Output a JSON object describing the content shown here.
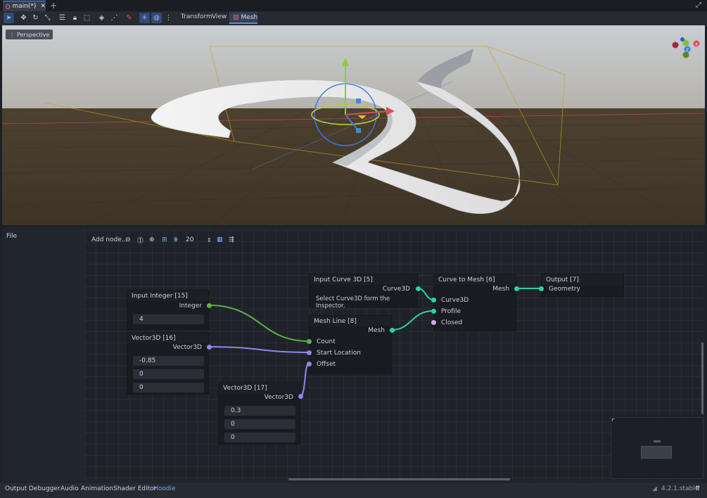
{
  "tabs": {
    "main_label": "main(*)",
    "add_icon": "plus-icon",
    "close_icon": "close-icon"
  },
  "toolbar": {
    "menus": [
      "Transform",
      "View",
      "Mesh"
    ],
    "icons": [
      "select-icon",
      "move-icon",
      "rotate-icon",
      "scale-icon",
      "list-select-icon",
      "lock-icon",
      "group-icon",
      "ruler-icon",
      "snap-icon",
      "local-icon",
      "camera-icon",
      "light-icon",
      "environment-icon",
      "more-icon"
    ]
  },
  "viewport": {
    "perspective_label": "Perspective",
    "gizmo_axes": [
      "Y",
      "Z",
      "X"
    ]
  },
  "editor": {
    "file_menu": "File",
    "graph_toolbar": {
      "add_node": "Add node...",
      "snap_value": "20"
    },
    "nodes": {
      "input_integer": {
        "title": "Input Integer [15]",
        "output": "Integer",
        "value": "4"
      },
      "vector3d_16": {
        "title": "Vector3D [16]",
        "output": "Vector3D",
        "values": [
          "-0.85",
          "0",
          "0"
        ]
      },
      "vector3d_17": {
        "title": "Vector3D [17]",
        "output": "Vector3D",
        "values": [
          "0.3",
          "0",
          "0"
        ]
      },
      "input_curve": {
        "title": "Input Curve 3D [5]",
        "output": "Curve3D",
        "message": "Select Curve3D form the Inspector."
      },
      "mesh_line": {
        "title": "Mesh Line [8]",
        "output": "Mesh",
        "inputs": [
          "Count",
          "Start Location",
          "Offset"
        ]
      },
      "curve_to_mesh": {
        "title": "Curve to Mesh [6]",
        "output": "Mesh",
        "inputs": [
          "Curve3D",
          "Profile",
          "Closed"
        ]
      },
      "output": {
        "title": "Output [7]",
        "input": "Geometry"
      }
    }
  },
  "bottom_panel": {
    "tabs": [
      "Output",
      "Debugger",
      "Audio",
      "Animation",
      "Shader Editor",
      "Hoodie"
    ],
    "active_tab": "Hoodie",
    "version": "4.2.1.stable"
  },
  "colors": {
    "integer_port": "#5fae4f",
    "vector_port": "#8f86f0",
    "mesh_port": "#2bd3a0",
    "closed_port": "#d7a4e8",
    "accent": "#5c8bd6"
  }
}
